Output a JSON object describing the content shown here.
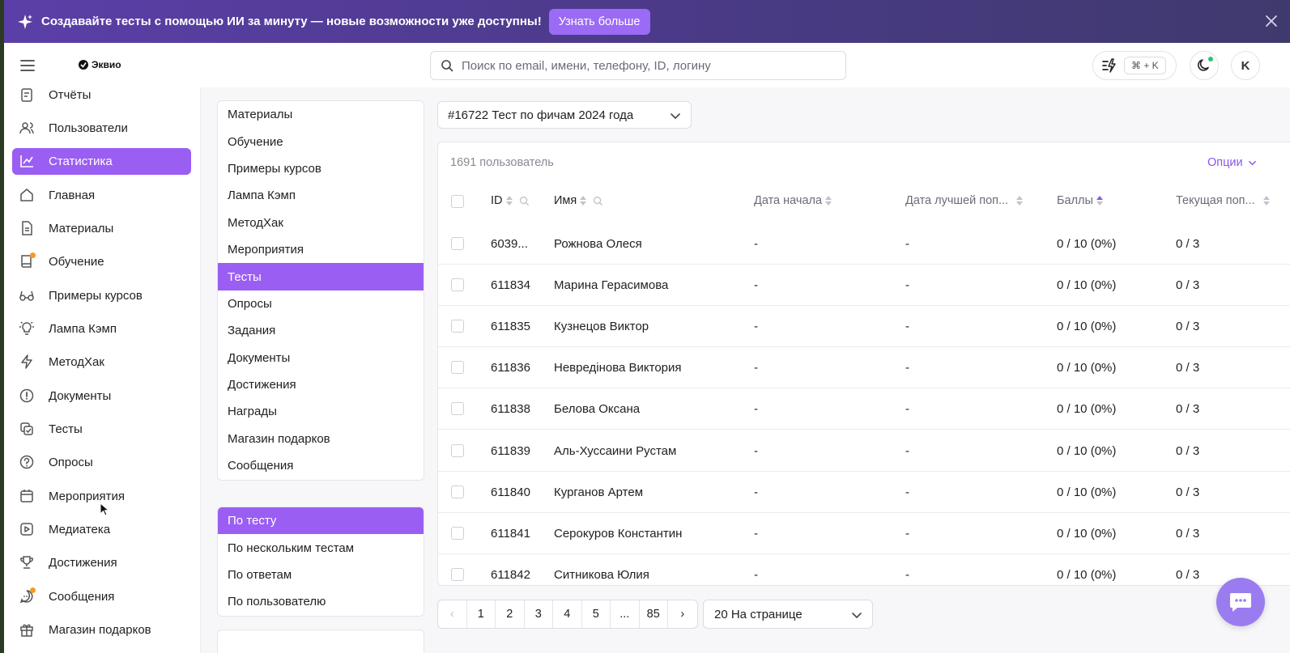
{
  "banner": {
    "text": "Создавайте тесты с помощью ИИ за минуту — новые возможности уже доступны!",
    "button": "Узнать больше",
    "close_icon": "close-icon"
  },
  "header": {
    "logo_text": "Эквио",
    "search_placeholder": "Поиск по email, имени, телефону, ID, логину",
    "shortcut": "⌘ + K",
    "avatar_initial": "K"
  },
  "sidebar": {
    "items": [
      {
        "label": "Отчёты",
        "icon": "report-icon"
      },
      {
        "label": "Пользователи",
        "icon": "users-icon"
      },
      {
        "label": "Статистика",
        "icon": "chart-icon",
        "active": true
      },
      {
        "label": "Главная",
        "icon": "home-icon"
      },
      {
        "label": "Материалы",
        "icon": "document-icon"
      },
      {
        "label": "Обучение",
        "icon": "book-icon",
        "badge": true
      },
      {
        "label": "Примеры курсов",
        "icon": "glasses-icon"
      },
      {
        "label": "Лампа Кэмп",
        "icon": "lightbulb-icon"
      },
      {
        "label": "МетодХак",
        "icon": "lightning-icon"
      },
      {
        "label": "Документы",
        "icon": "info-icon"
      },
      {
        "label": "Тесты",
        "icon": "test-icon"
      },
      {
        "label": "Опросы",
        "icon": "question-icon"
      },
      {
        "label": "Мероприятия",
        "icon": "calendar-icon"
      },
      {
        "label": "Медиатека",
        "icon": "play-icon"
      },
      {
        "label": "Достижения",
        "icon": "trophy-icon"
      },
      {
        "label": "Сообщения",
        "icon": "message-icon",
        "badge": true
      },
      {
        "label": "Магазин подарков",
        "icon": "gift-icon"
      }
    ]
  },
  "sections": {
    "items": [
      "Материалы",
      "Обучение",
      "Примеры курсов",
      "Лампа Кэмп",
      "МетодХак",
      "Мероприятия",
      "Тесты",
      "Опросы",
      "Задания",
      "Документы",
      "Достижения",
      "Награды",
      "Магазин подарков",
      "Сообщения"
    ],
    "active_index": 6
  },
  "report_types": {
    "items": [
      "По тесту",
      "По нескольким тестам",
      "По ответам",
      "По пользователю"
    ],
    "active_index": 0
  },
  "test_select": {
    "value": "#16722 Тест по фичам 2024 года"
  },
  "table": {
    "count": "1691 пользователь",
    "options": "Опции",
    "columns": [
      "ID",
      "Имя",
      "Дата начала",
      "Дата лучшей поп...",
      "Баллы",
      "Текущая поп..."
    ],
    "rows": [
      [
        "6039...",
        "Рожнова Олеся",
        "-",
        "-",
        "0 / 10 (0%)",
        "0 / 3"
      ],
      [
        "611834",
        "Марина Герасимова",
        "-",
        "-",
        "0 / 10 (0%)",
        "0 / 3"
      ],
      [
        "611835",
        "Кузнецов Виктор",
        "-",
        "-",
        "0 / 10 (0%)",
        "0 / 3"
      ],
      [
        "611836",
        "Невредiнова Виктория",
        "-",
        "-",
        "0 / 10 (0%)",
        "0 / 3"
      ],
      [
        "611838",
        "Белова Оксана",
        "-",
        "-",
        "0 / 10 (0%)",
        "0 / 3"
      ],
      [
        "611839",
        "Аль-Хуссаини Рустам",
        "-",
        "-",
        "0 / 10 (0%)",
        "0 / 3"
      ],
      [
        "611840",
        "Курганов Артем",
        "-",
        "-",
        "0 / 10 (0%)",
        "0 / 3"
      ],
      [
        "611841",
        "Серокуров Константин",
        "-",
        "-",
        "0 / 10 (0%)",
        "0 / 3"
      ],
      [
        "611842",
        "Ситникова Юлия",
        "-",
        "-",
        "0 / 10 (0%)",
        "0 / 3"
      ]
    ]
  },
  "pagination": {
    "pages": [
      "‹",
      "1",
      "2",
      "3",
      "4",
      "5",
      "...",
      "85",
      "›"
    ],
    "per_page": "20 На странице"
  },
  "colors": {
    "accent": "#9b5ef2",
    "banner": "#4a3a86",
    "online": "#2ec36a"
  }
}
